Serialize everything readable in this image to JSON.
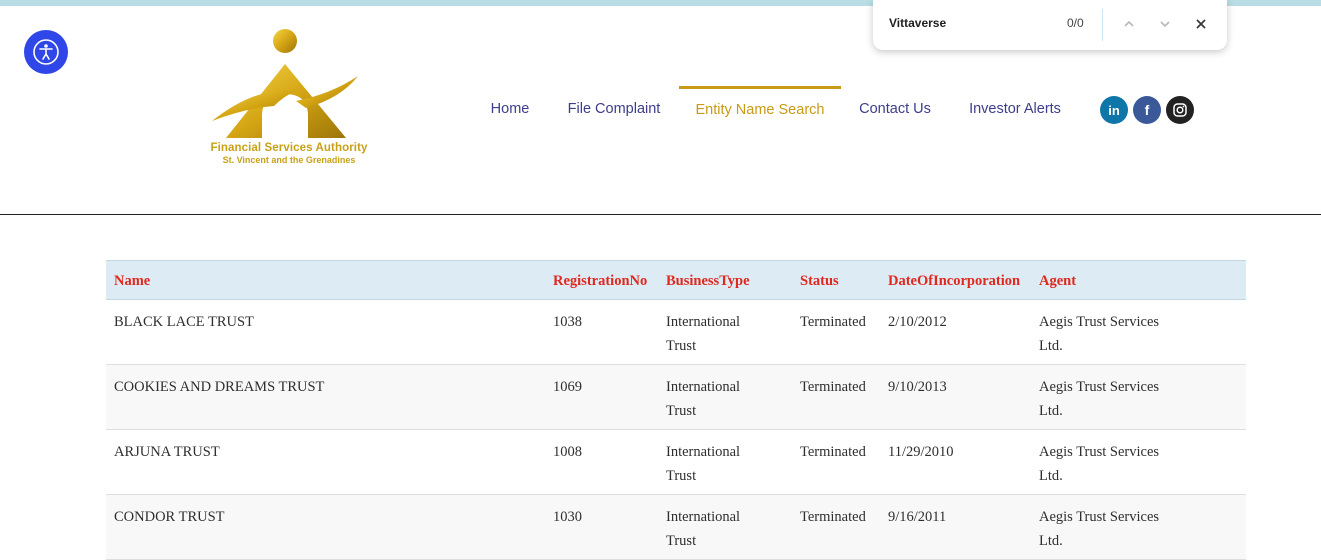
{
  "find_bar": {
    "query": "Vittaverse",
    "count": "0/0"
  },
  "logo": {
    "line1": "Financial Services Authority",
    "line2": "St. Vincent and the Grenadines"
  },
  "nav": {
    "items": [
      {
        "label": "Home"
      },
      {
        "label": "File Complaint"
      },
      {
        "label": "Entity Name Search",
        "active": true
      },
      {
        "label": "Contact Us"
      },
      {
        "label": "Investor Alerts"
      }
    ]
  },
  "social": {
    "linkedin": "in",
    "facebook": "f"
  },
  "colors": {
    "nav_text": "#3d3d8c",
    "nav_active": "#c99a16",
    "header_text": "#e0281e",
    "header_bg": "#ddebf5",
    "accessibility": "#2f46e9"
  },
  "table": {
    "columns": [
      "Name",
      "RegistrationNo",
      "BusinessType",
      "Status",
      "DateOfIncorporation",
      "Agent"
    ],
    "rows": [
      {
        "name": "BLACK LACE TRUST",
        "reg": "1038",
        "type_line1": "International",
        "type_line2": "Trust",
        "status": "Terminated",
        "date": "2/10/2012",
        "agent_line1": "Aegis Trust Services",
        "agent_line2": "Ltd."
      },
      {
        "name": "COOKIES AND DREAMS TRUST",
        "reg": "1069",
        "type_line1": "International",
        "type_line2": "Trust",
        "status": "Terminated",
        "date": "9/10/2013",
        "agent_line1": "Aegis Trust Services",
        "agent_line2": "Ltd."
      },
      {
        "name": "ARJUNA TRUST",
        "reg": "1008",
        "type_line1": "International",
        "type_line2": "Trust",
        "status": "Terminated",
        "date": "11/29/2010",
        "agent_line1": "Aegis Trust Services",
        "agent_line2": "Ltd."
      },
      {
        "name": "CONDOR TRUST",
        "reg": "1030",
        "type_line1": "International",
        "type_line2": "Trust",
        "status": "Terminated",
        "date": "9/16/2011",
        "agent_line1": "Aegis Trust Services",
        "agent_line2": "Ltd."
      }
    ]
  }
}
